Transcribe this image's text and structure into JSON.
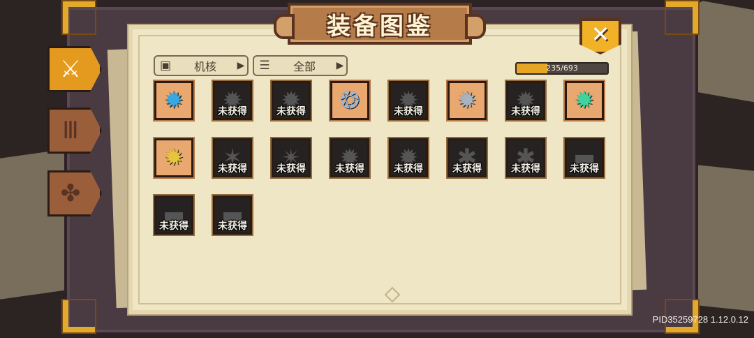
{
  "title": "装备图鉴",
  "close_label": "✕",
  "side_tabs": [
    {
      "icon": "sword-icon",
      "glyph": "⚔",
      "active": true
    },
    {
      "icon": "bars-icon",
      "glyph": "Ⅲ",
      "active": false
    },
    {
      "icon": "clover-icon",
      "glyph": "✤",
      "active": false
    }
  ],
  "filters": [
    {
      "icon": "core-icon",
      "glyph": "▣",
      "label": "机核",
      "arrow": "▶"
    },
    {
      "icon": "list-icon",
      "glyph": "☰",
      "label": "全部",
      "arrow": "▶"
    }
  ],
  "progress": {
    "text": "235/693",
    "fraction": 0.338
  },
  "locked_label": "未获得",
  "items": [
    {
      "name": "blue-gear",
      "glyph": "✹",
      "color": "#3aa7e0",
      "owned": true
    },
    {
      "name": "dark-gear-1",
      "glyph": "✹",
      "owned": false
    },
    {
      "name": "dark-gear-2",
      "glyph": "✹",
      "owned": false
    },
    {
      "name": "chain-gear",
      "glyph": "❂",
      "color": "#9fb8d6",
      "owned": true
    },
    {
      "name": "dark-gear-3",
      "glyph": "✹",
      "owned": false
    },
    {
      "name": "silver-gear",
      "glyph": "✹",
      "color": "#a9b2bd",
      "owned": true
    },
    {
      "name": "dark-gear-4",
      "glyph": "✹",
      "owned": false
    },
    {
      "name": "green-gear",
      "glyph": "✹",
      "color": "#3fd3a0",
      "owned": true
    },
    {
      "name": "gold-gear",
      "glyph": "✹",
      "color": "#e8c43c",
      "owned": true
    },
    {
      "name": "dark-blade",
      "glyph": "✶",
      "owned": false
    },
    {
      "name": "dark-star",
      "glyph": "✴",
      "owned": false
    },
    {
      "name": "dark-wheel",
      "glyph": "✹",
      "owned": false
    },
    {
      "name": "dark-cog",
      "glyph": "✹",
      "owned": false
    },
    {
      "name": "dark-crank",
      "glyph": "✱",
      "owned": false
    },
    {
      "name": "dark-wing",
      "glyph": "✱",
      "owned": false
    },
    {
      "name": "dark-box",
      "glyph": "▬",
      "owned": false
    },
    {
      "name": "dark-block-1",
      "glyph": "▬",
      "owned": false
    },
    {
      "name": "dark-block-2",
      "glyph": "▬",
      "owned": false
    }
  ],
  "version_text": "PID35259728 1.12.0.12"
}
